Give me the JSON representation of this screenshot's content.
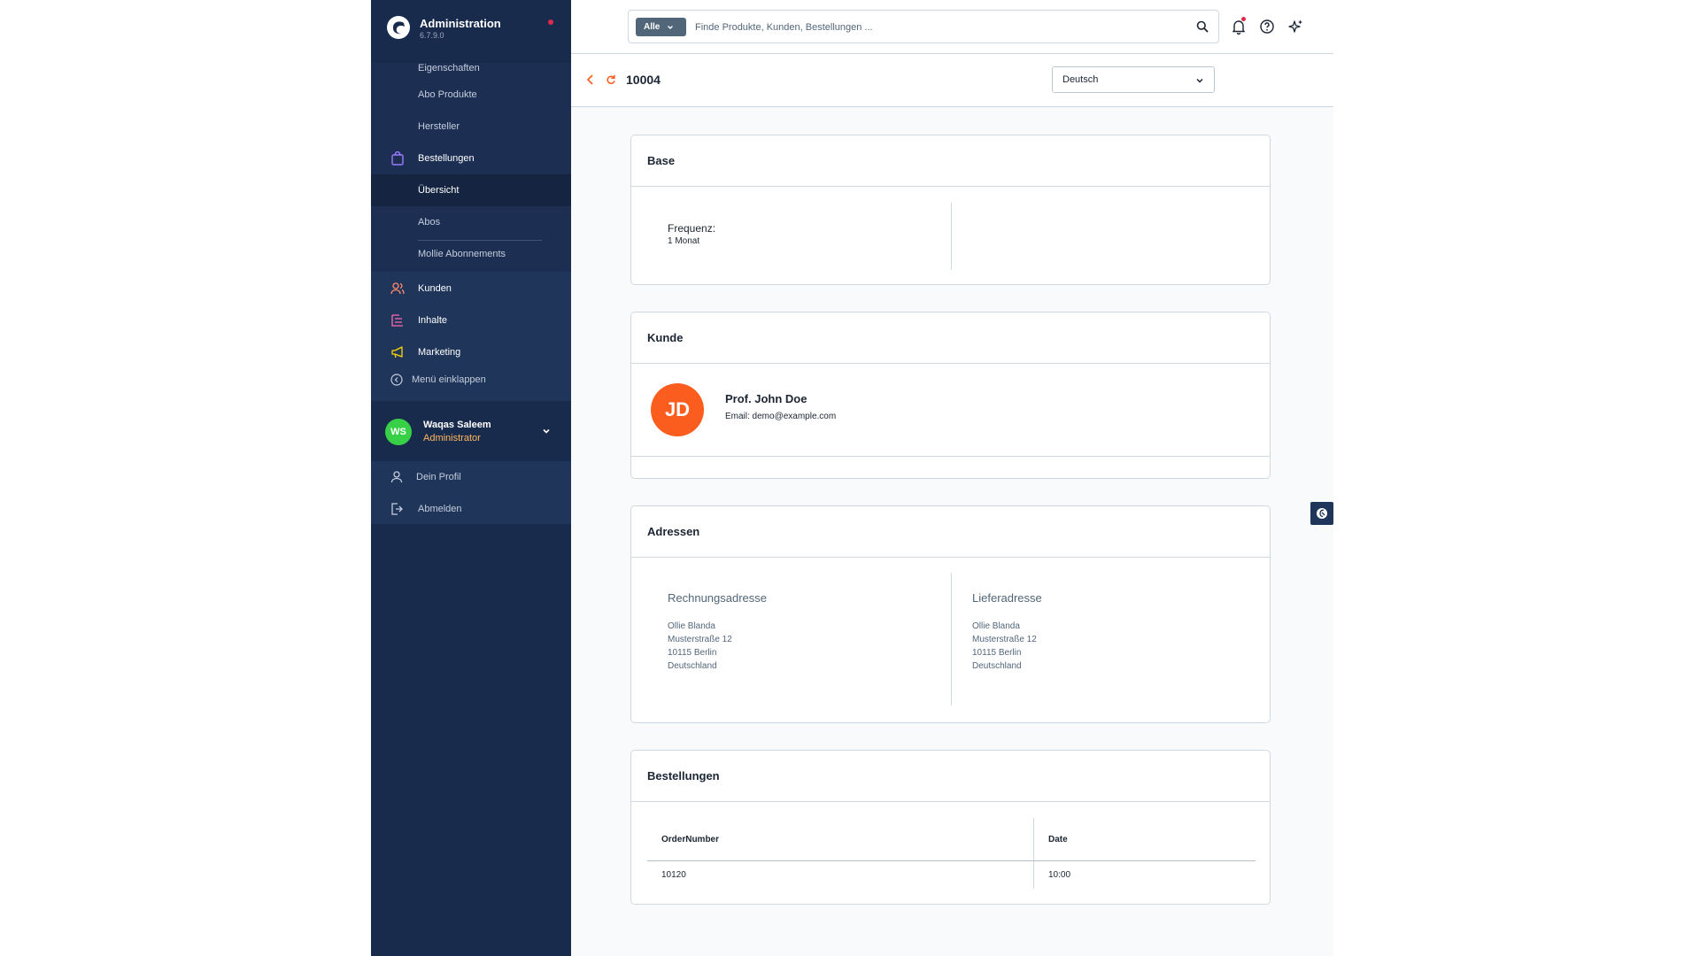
{
  "app": {
    "title": "Administration",
    "version": "6.7.9.0"
  },
  "sidebar": {
    "items": [
      {
        "label": "Eigenschaften"
      },
      {
        "label": "Abo Produkte"
      },
      {
        "label": "Hersteller"
      },
      {
        "label": "Bestellungen",
        "icon": "shopping-bag-icon"
      },
      {
        "label": "Übersicht"
      },
      {
        "label": "Abos"
      },
      {
        "label": "Mollie Abonnements"
      },
      {
        "label": "Kunden",
        "icon": "users-icon"
      },
      {
        "label": "Inhalte",
        "icon": "content-icon"
      },
      {
        "label": "Marketing",
        "icon": "megaphone-icon"
      }
    ],
    "collapse_label": "Menü einklappen",
    "user": {
      "initials": "WS",
      "name": "Waqas Saleem",
      "role": "Administrator"
    },
    "user_menu": [
      {
        "label": "Dein Profil"
      },
      {
        "label": "Abmelden"
      }
    ]
  },
  "search": {
    "type_label": "Alle",
    "placeholder": "Finde Produkte, Kunden, Bestellungen ..."
  },
  "smartbar": {
    "title": "10004",
    "language": "Deutsch"
  },
  "base": {
    "title": "Base",
    "freq_label": "Frequenz:",
    "freq_value": "1 Monat"
  },
  "customer": {
    "title": "Kunde",
    "initials": "JD",
    "name": "Prof. John Doe",
    "email": "Email: demo@example.com"
  },
  "addresses": {
    "title": "Adressen",
    "billing": {
      "title": "Rechnungsadresse",
      "name": "Ollie Blanda",
      "street": "Musterstraße 12",
      "city": "10115 Berlin",
      "country": "Deutschland"
    },
    "shipping": {
      "title": "Lieferadresse",
      "name": "Ollie Blanda",
      "street": "Musterstraße 12",
      "city": "10115 Berlin",
      "country": "Deutschland"
    }
  },
  "orders": {
    "title": "Bestellungen",
    "columns": [
      "OrderNumber",
      "Date"
    ],
    "rows": [
      [
        "10120",
        "10:00"
      ]
    ]
  },
  "colors": {
    "accent": "#fa5d1e",
    "sidebar": "#20355a",
    "brand_blue": "#189eff"
  }
}
